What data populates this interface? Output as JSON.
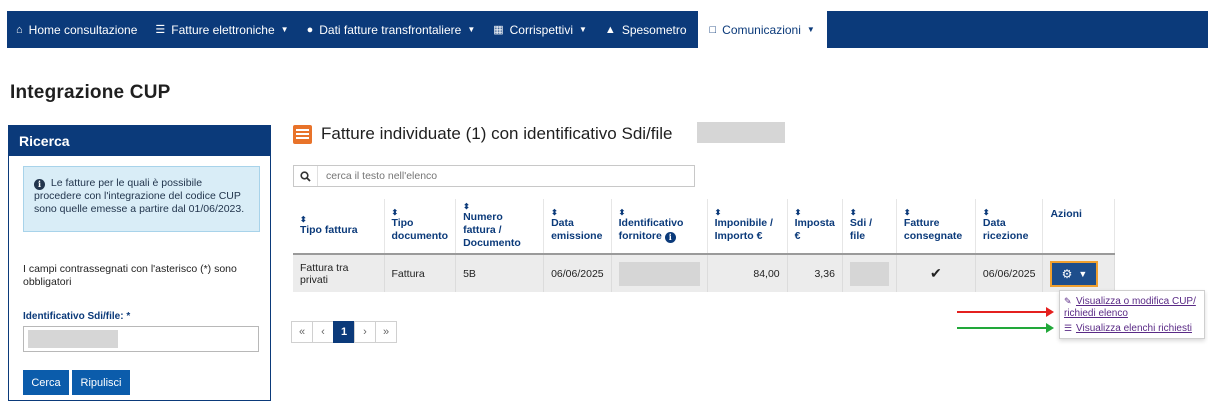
{
  "nav": {
    "items": [
      {
        "label": "Home consultazione",
        "icon": "home-icon",
        "glyph": "⌂",
        "caret": false
      },
      {
        "label": "Fatture elettroniche",
        "icon": "document-icon",
        "glyph": "☰",
        "caret": true
      },
      {
        "label": "Dati fatture transfrontaliere",
        "icon": "globe-icon",
        "glyph": "●",
        "caret": true
      },
      {
        "label": "Corrispettivi",
        "icon": "calculator-icon",
        "glyph": "▦",
        "caret": true
      },
      {
        "label": "Spesometro",
        "icon": "bag-icon",
        "glyph": "▲",
        "caret": false
      },
      {
        "label": "Comunicazioni",
        "icon": "file-icon",
        "glyph": "□",
        "caret": true,
        "active": true
      }
    ],
    "colors": {
      "bar": "#0b3a7a",
      "active_text": "#0b3a7a"
    }
  },
  "page": {
    "title": "Integrazione CUP"
  },
  "search_panel": {
    "title": "Ricerca",
    "info_text": "Le fatture per le quali è possibile procedere con l'integrazione del codice CUP sono quelle emesse a partire dal 01/06/2023.",
    "required_note": "I campi contrassegnati con l'asterisco (*) sono obbligatori",
    "field_label": "Identificativo Sdi/file: *",
    "field_value": "",
    "search_button": "Cerca",
    "reset_button": "Ripulisci"
  },
  "results": {
    "title": "Fatture individuate (1) con identificativo Sdi/file",
    "filter_placeholder": "cerca il testo nell'elenco",
    "columns": [
      {
        "label": "Tipo fattura",
        "sortable": true
      },
      {
        "label": "Tipo documento",
        "sortable": true
      },
      {
        "label": "Numero fattura / Documento",
        "sortable": true
      },
      {
        "label": "Data emissione",
        "sortable": true
      },
      {
        "label": "Identificativo fornitore",
        "sortable": true,
        "info_icon": true
      },
      {
        "label": "Imponibile / Importo €",
        "sortable": true
      },
      {
        "label": "Imposta €",
        "sortable": true
      },
      {
        "label": "Sdi / file",
        "sortable": true
      },
      {
        "label": "Fatture consegnate",
        "sortable": true
      },
      {
        "label": "Data ricezione",
        "sortable": true
      },
      {
        "label": "Azioni",
        "sortable": false
      }
    ],
    "rows": [
      {
        "tipo_fattura": "Fattura tra privati",
        "tipo_documento": "Fattura",
        "numero": "5B",
        "data_emissione": "06/06/2025",
        "identificativo_fornitore": "",
        "imponibile": "84,00",
        "imposta": "3,36",
        "sdi_file": "",
        "consegnata": true,
        "data_ricezione": "06/06/2025"
      }
    ],
    "pagination": {
      "first": "«",
      "prev": "‹",
      "current": "1",
      "next": "›",
      "last": "»"
    }
  },
  "actions_menu": {
    "items": [
      {
        "label": "Visualizza o modifica CUP/ richiedi elenco",
        "icon": "pencil-icon"
      },
      {
        "label": "Visualizza elenchi richiesti",
        "icon": "list-icon"
      }
    ]
  },
  "annotations": {
    "arrow_colors": [
      "#e4201f",
      "#22a83a"
    ]
  },
  "colors": {
    "accent_orange": "#e8732a",
    "link_purple": "#5a2a86",
    "check_green": "#1f8f2a",
    "button_blue": "#0b5cab"
  }
}
